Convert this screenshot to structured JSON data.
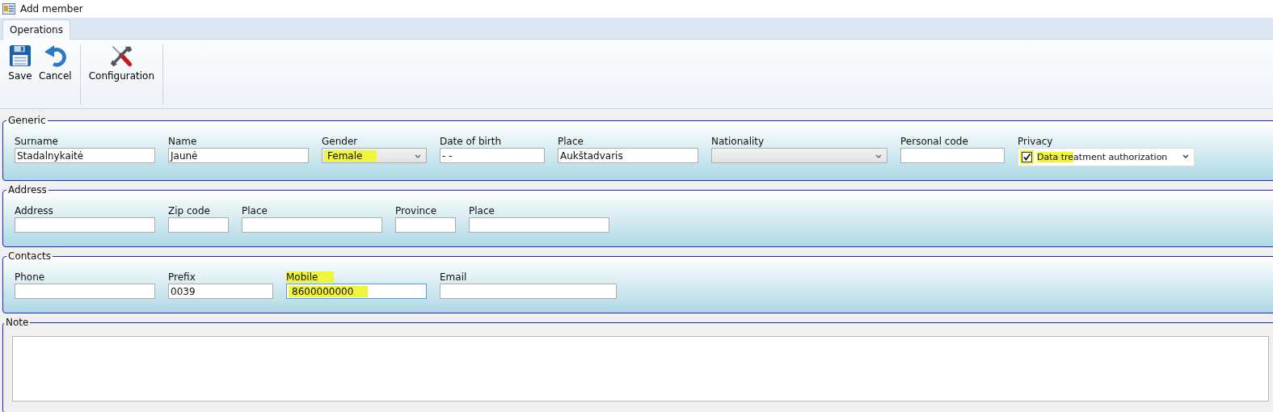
{
  "window": {
    "title": "Add member"
  },
  "tabs": [
    {
      "label": "Operations",
      "selected": true
    }
  ],
  "toolbar": {
    "groups": [
      [
        {
          "label": "Save",
          "kind": "save"
        },
        {
          "label": "Cancel",
          "kind": "cancel"
        }
      ],
      [
        {
          "label": "Configuration",
          "kind": "config"
        }
      ]
    ]
  },
  "groups": [
    {
      "title": "Generic",
      "fields": [
        {
          "label": "Surname",
          "kind": "text",
          "value": "Stadalnykaitė",
          "highlighted": false
        },
        {
          "label": "Name",
          "kind": "text",
          "value": "Jaunė",
          "highlighted": false
        },
        {
          "label": "Gender",
          "kind": "combo",
          "value": "Female",
          "highlighted": true
        },
        {
          "label": "Date of birth",
          "kind": "text",
          "value": " -  -",
          "highlighted": false
        },
        {
          "label": "Place",
          "kind": "text",
          "value": "Aukštadvaris",
          "highlighted": false
        },
        {
          "label": "Nationality",
          "kind": "combo"
        },
        {
          "label": "Personal code",
          "kind": "text"
        },
        {
          "label": "Privacy",
          "kind": "checkcombo",
          "value": "Data treatment authorization",
          "checked": true,
          "highlighted": true
        }
      ]
    },
    {
      "title": "Address",
      "fields": [
        {
          "label": "Address",
          "kind": "text"
        },
        {
          "label": "Zip code",
          "kind": "text"
        },
        {
          "label": "Place",
          "kind": "text"
        },
        {
          "label": "Province",
          "kind": "text"
        },
        {
          "label": "Place",
          "kind": "text"
        }
      ]
    },
    {
      "title": "Contacts",
      "fields": [
        {
          "label": "Phone",
          "kind": "text"
        },
        {
          "label": "Prefix",
          "kind": "text",
          "value": "0039",
          "highlighted": false
        },
        {
          "label": "Mobile",
          "kind": "text",
          "value": "8600000000",
          "highlighted": true,
          "focused": true
        },
        {
          "label": "Email",
          "kind": "text"
        }
      ]
    },
    {
      "title": "Note",
      "kind": "note"
    }
  ]
}
